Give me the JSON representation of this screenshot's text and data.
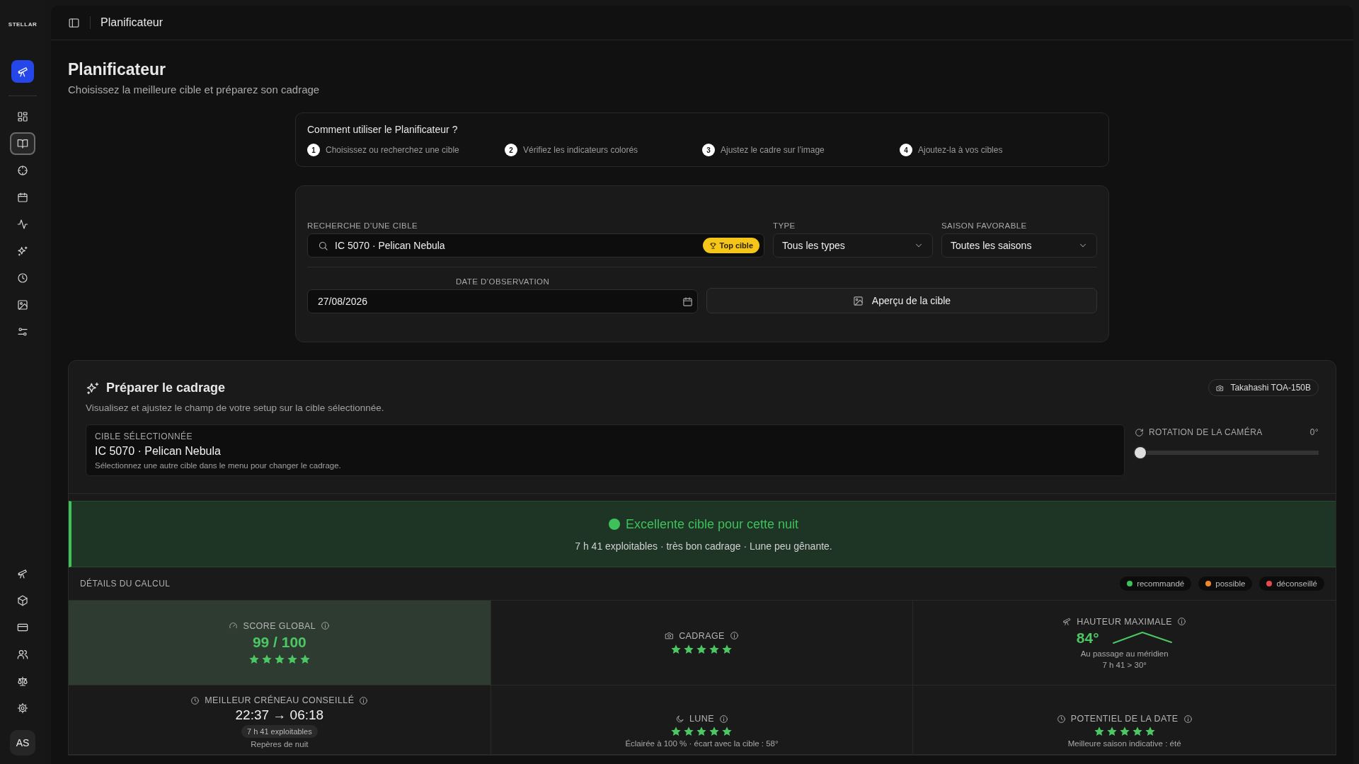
{
  "sidebar": {
    "logo": "STELLAR",
    "items": [
      {
        "selected": false
      },
      {
        "selected": true
      },
      {
        "selected": false
      },
      {
        "selected": false
      },
      {
        "selected": false
      },
      {
        "selected": false
      },
      {
        "selected": false
      },
      {
        "selected": false
      },
      {
        "selected": false
      }
    ],
    "avatar": "AS"
  },
  "header": {
    "title": "Planificateur"
  },
  "page": {
    "title": "Planificateur",
    "subtitle": "Choisissez la meilleure cible et préparez son cadrage"
  },
  "howto": {
    "title": "Comment utiliser le Planificateur ?",
    "steps": [
      {
        "number": "1",
        "text": "Choisissez ou recherchez une cible"
      },
      {
        "number": "2",
        "text": "Vérifiez les indicateurs colorés"
      },
      {
        "number": "3",
        "text": "Ajustez le cadre sur l’image"
      },
      {
        "number": "4",
        "text": "Ajoutez-la à vos cibles"
      }
    ]
  },
  "search": {
    "label": "RECHERCHE D’UNE CIBLE",
    "value": "IC 5070 · Pelican Nebula",
    "badge": "Top cible",
    "type_label": "TYPE",
    "type_value": "Tous les types",
    "season_label": "SAISON FAVORABLE",
    "season_value": "Toutes les saisons",
    "date_label": "DATE D’OBSERVATION",
    "date_value": "27/08/2026",
    "preview_button": "Aperçu de la cible"
  },
  "framing": {
    "title": "Préparer le cadrage",
    "subtitle": "Visualisez et ajustez le champ de votre setup sur la cible sélectionnée.",
    "camera": "Takahashi TOA-150B",
    "target_label": "CIBLE SÉLECTIONNÉE",
    "target_name": "IC 5070 · Pelican Nebula",
    "target_hint": "Sélectionnez une autre cible dans le menu pour changer le cadrage.",
    "rotation_label": "ROTATION DE LA CAMÉRA",
    "rotation_reading": "0°",
    "rotation": {
      "level": 0
    }
  },
  "verdict": {
    "color": "#3ec15a",
    "title": "Excellente cible pour cette nuit",
    "summary": "7 h 41 exploitables · très bon cadrage · Lune peu gênante."
  },
  "details": {
    "title": "DÉTAILS DU CALCUL",
    "legend": [
      {
        "label": "recommandé",
        "color": "#3ec15a"
      },
      {
        "label": "possible",
        "color": "#f0882a"
      },
      {
        "label": "déconseillé",
        "color": "#e5484d"
      }
    ],
    "cells": [
      {
        "kind": "score",
        "label": "SCORE GLOBAL",
        "highlighted": true,
        "value": "99 / 100",
        "stars": 5
      },
      {
        "kind": "stars",
        "label": "CADRAGE",
        "highlighted": false,
        "stars": 5
      },
      {
        "kind": "altitude",
        "label": "HAUTEUR MAXIMALE",
        "highlighted": false,
        "value": "84°",
        "lines": [
          "Au passage au méridien",
          "7 h 41 > 30°"
        ]
      },
      {
        "kind": "window",
        "label": "MEILLEUR CRÉNEAU CONSEILLÉ",
        "highlighted": false,
        "value": "22:37 → 06:18",
        "pill": "7 h 41 exploitables",
        "note": "Repères de nuit"
      },
      {
        "kind": "stars",
        "label": "LUNE",
        "highlighted": false,
        "stars": 5,
        "note": "Éclairée à 100 % · écart avec la cible : 58°"
      },
      {
        "kind": "stars",
        "label": "POTENTIEL DE LA DATE",
        "highlighted": false,
        "stars": 5,
        "note": "Meilleure saison indicative : été"
      }
    ]
  }
}
